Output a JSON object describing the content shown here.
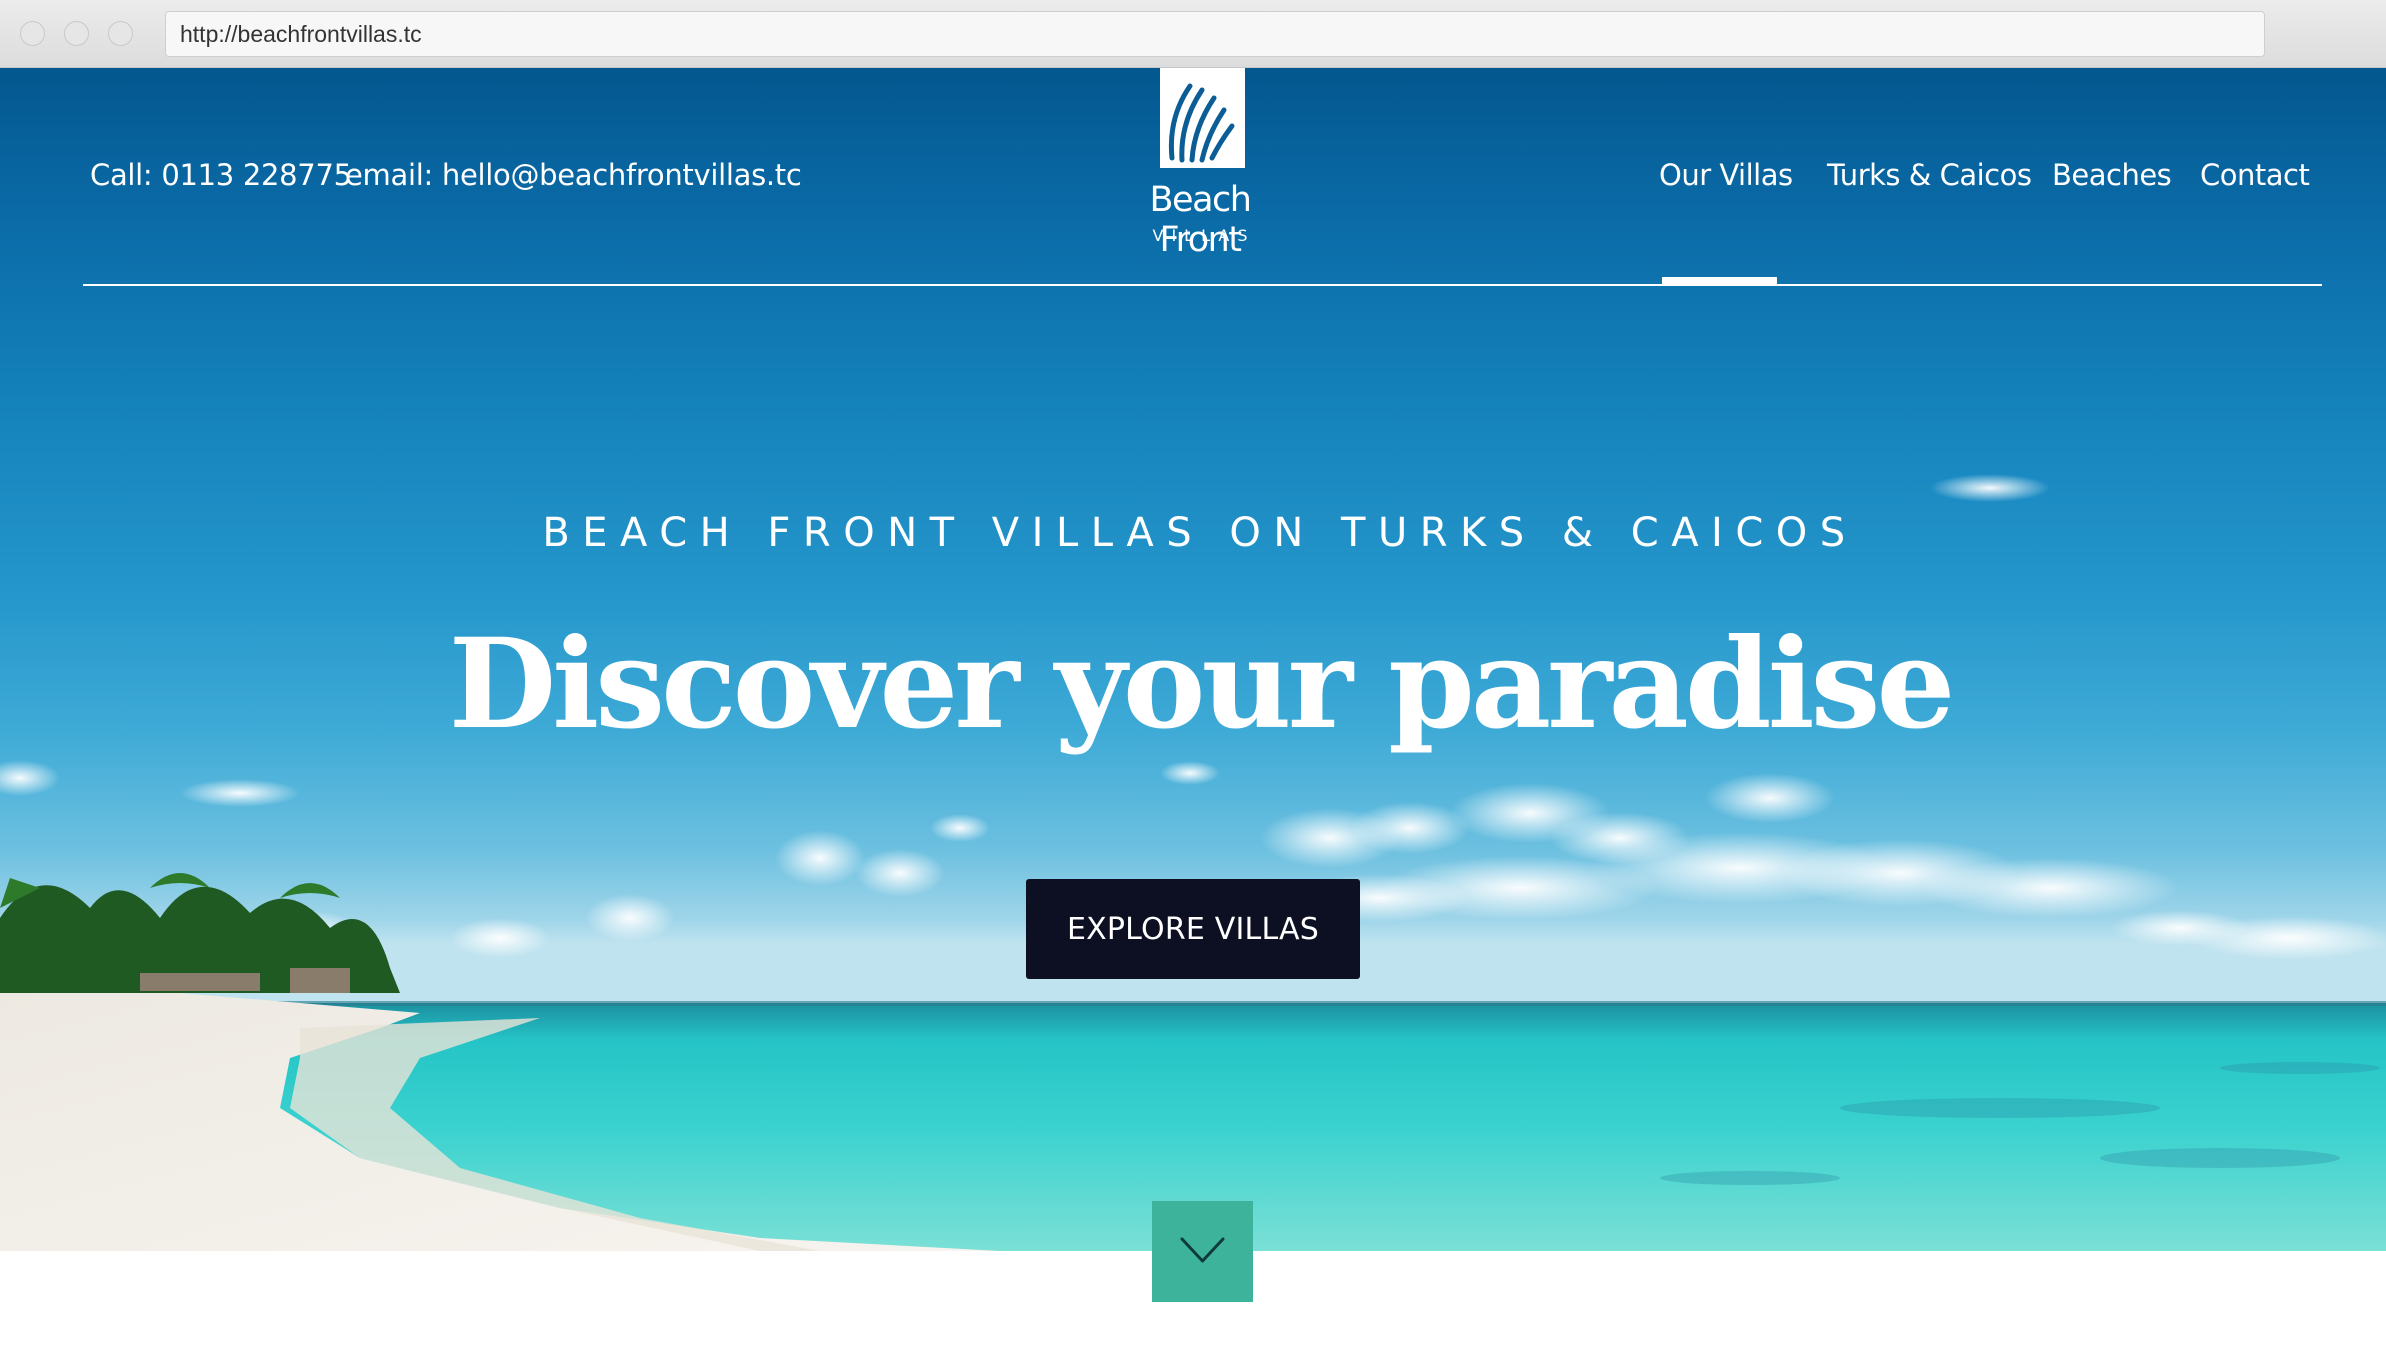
{
  "browser": {
    "url": "http://beachfrontvillas.tc"
  },
  "header": {
    "call": "Call: 0113 228775",
    "email": "email: hello@beachfrontvillas.tc",
    "logo": {
      "title": "Beach Front",
      "subtitle": "VILLAS",
      "icon": "shell-logo-icon"
    },
    "nav": [
      {
        "label": "Our Villas",
        "active": true
      },
      {
        "label": "Turks & Caicos",
        "active": false
      },
      {
        "label": "Beaches",
        "active": false
      },
      {
        "label": "Contact",
        "active": false
      }
    ]
  },
  "hero": {
    "kicker": "BEACH FRONT VILLAS ON TURKS & CAICOS",
    "title": "Discover your paradise",
    "cta_label": "EXPLORE VILLAS",
    "scroll_icon": "chevron-down-icon"
  },
  "colors": {
    "sky_top": "#04578f",
    "sea": "#2fd0d0",
    "button_bg": "#0d0f22",
    "scroll_button_bg": "#3eb39c"
  }
}
